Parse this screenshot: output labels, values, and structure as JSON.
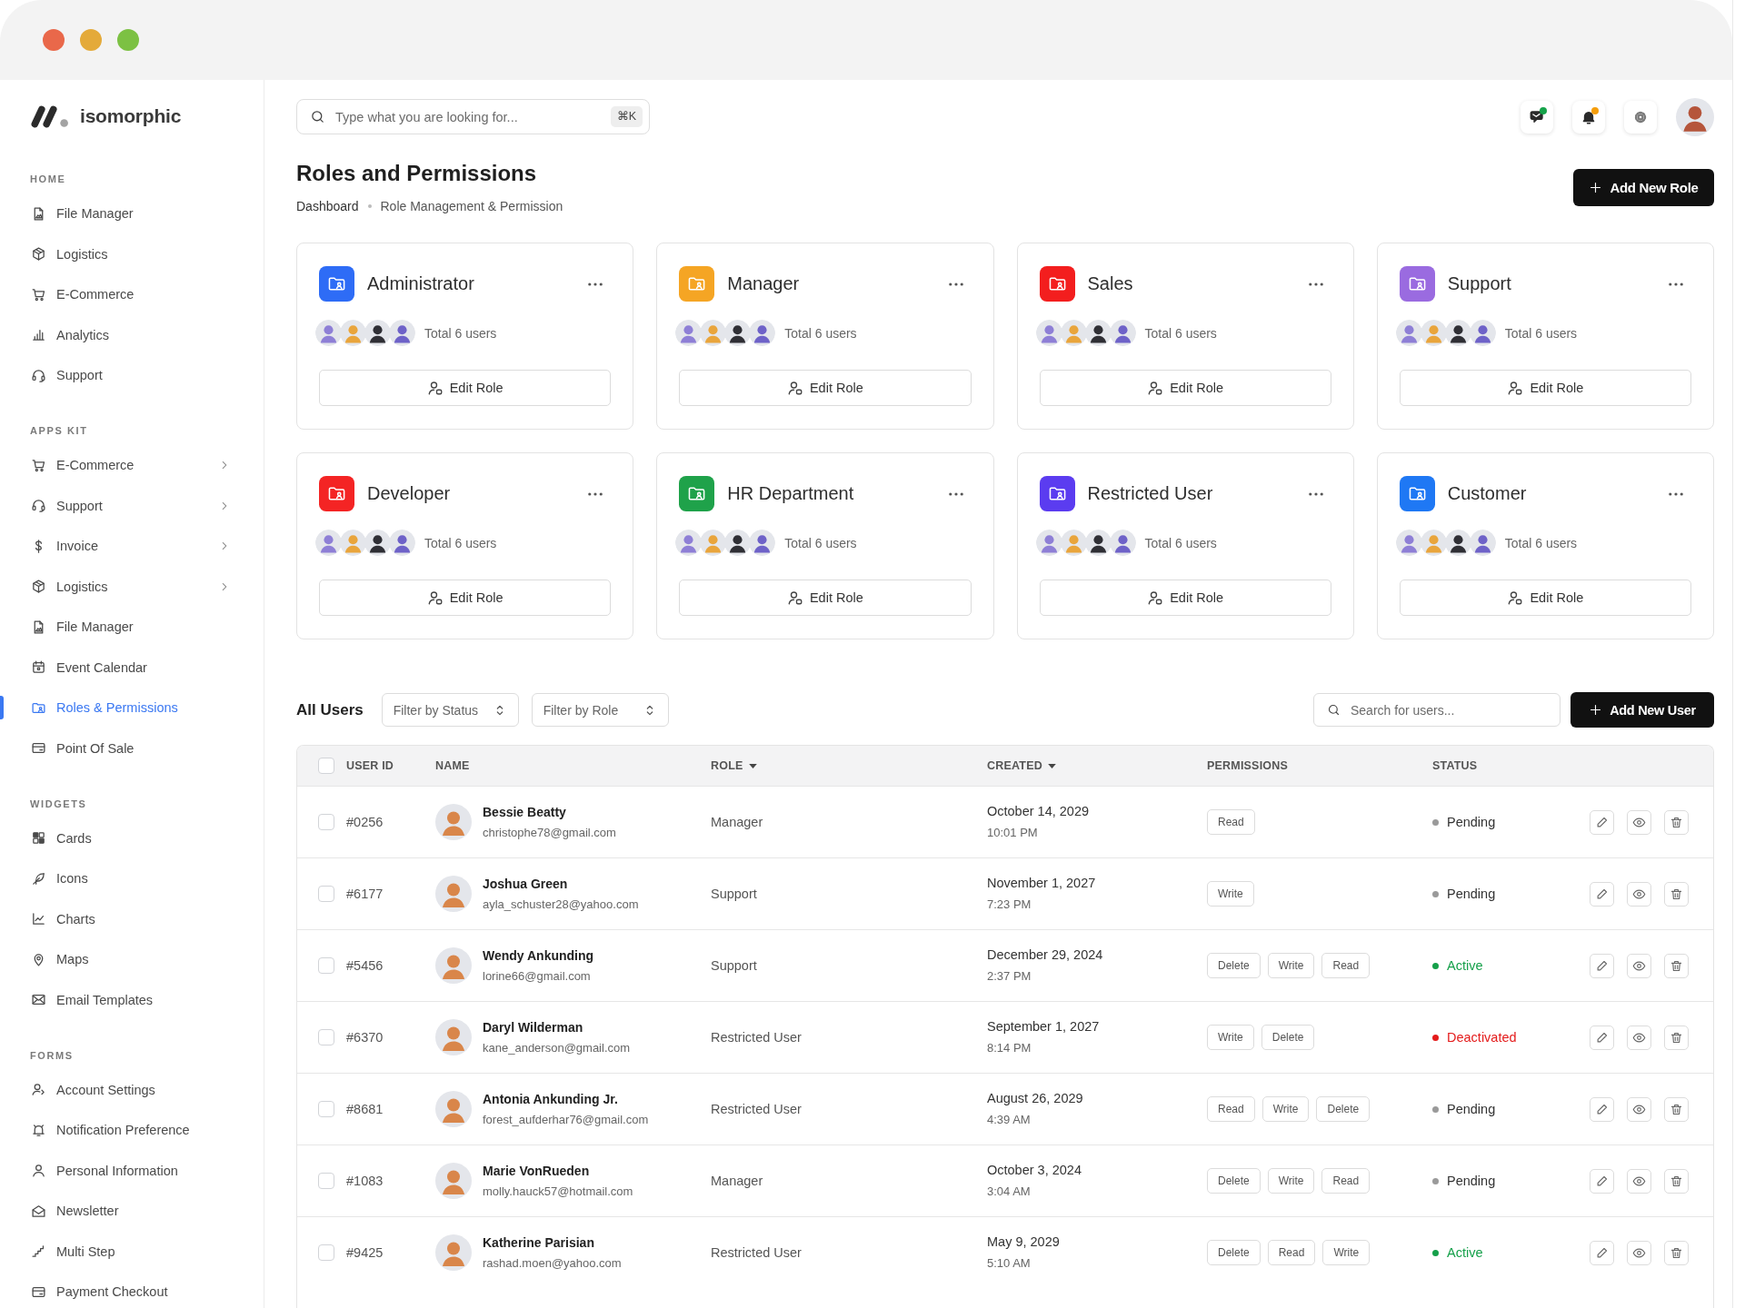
{
  "brand": {
    "name": "isomorphic"
  },
  "search": {
    "placeholder": "Type what you are looking for...",
    "shortcut": "⌘K"
  },
  "header": {
    "messages_unread": true,
    "notifications_unread": true
  },
  "sidebar": {
    "sections": [
      {
        "label": "HOME",
        "items": [
          {
            "label": "File Manager",
            "selected": false,
            "submenu": false
          },
          {
            "label": "Logistics",
            "selected": false,
            "submenu": false
          },
          {
            "label": "E-Commerce",
            "selected": false,
            "submenu": false
          },
          {
            "label": "Analytics",
            "selected": false,
            "submenu": false
          },
          {
            "label": "Support",
            "selected": false,
            "submenu": false
          }
        ]
      },
      {
        "label": "APPS KIT",
        "items": [
          {
            "label": "E-Commerce",
            "selected": false,
            "submenu": true
          },
          {
            "label": "Support",
            "selected": false,
            "submenu": true
          },
          {
            "label": "Invoice",
            "selected": false,
            "submenu": true
          },
          {
            "label": "Logistics",
            "selected": false,
            "submenu": true
          },
          {
            "label": "File Manager",
            "selected": false,
            "submenu": false
          },
          {
            "label": "Event Calendar",
            "selected": false,
            "submenu": false
          },
          {
            "label": "Roles & Permissions",
            "selected": true,
            "submenu": false
          },
          {
            "label": "Point Of Sale",
            "selected": false,
            "submenu": false
          }
        ]
      },
      {
        "label": "WIDGETS",
        "items": [
          {
            "label": "Cards",
            "selected": false,
            "submenu": false
          },
          {
            "label": "Icons",
            "selected": false,
            "submenu": false
          },
          {
            "label": "Charts",
            "selected": false,
            "submenu": false
          },
          {
            "label": "Maps",
            "selected": false,
            "submenu": false
          },
          {
            "label": "Email Templates",
            "selected": false,
            "submenu": false
          }
        ]
      },
      {
        "label": "FORMS",
        "items": [
          {
            "label": "Account Settings",
            "selected": false,
            "submenu": false
          },
          {
            "label": "Notification Preference",
            "selected": false,
            "submenu": false
          },
          {
            "label": "Personal Information",
            "selected": false,
            "submenu": false
          },
          {
            "label": "Newsletter",
            "selected": false,
            "submenu": false
          },
          {
            "label": "Multi Step",
            "selected": false,
            "submenu": false
          },
          {
            "label": "Payment Checkout",
            "selected": false,
            "submenu": false
          }
        ]
      }
    ]
  },
  "page": {
    "title": "Roles and Permissions",
    "breadcrumb": [
      "Dashboard",
      "Role Management & Permission"
    ],
    "primary_action": "Add New Role"
  },
  "roles": [
    {
      "name": "Administrator",
      "color": "#2e6cf6",
      "users": "Total 6 users",
      "action": "Edit Role"
    },
    {
      "name": "Manager",
      "color": "#f5a524",
      "users": "Total 6 users",
      "action": "Edit Role"
    },
    {
      "name": "Sales",
      "color": "#f31e1e",
      "users": "Total 6 users",
      "action": "Edit Role"
    },
    {
      "name": "Support",
      "color": "#9a6be0",
      "users": "Total 6 users",
      "action": "Edit Role"
    },
    {
      "name": "Developer",
      "color": "#f42424",
      "users": "Total 6 users",
      "action": "Edit Role"
    },
    {
      "name": "HR Department",
      "color": "#1fa24a",
      "users": "Total 6 users",
      "action": "Edit Role"
    },
    {
      "name": "Restricted User",
      "color": "#5b3cf0",
      "users": "Total 6 users",
      "action": "Edit Role"
    },
    {
      "name": "Customer",
      "color": "#1f78f4",
      "users": "Total 6 users",
      "action": "Edit Role"
    }
  ],
  "users_table": {
    "title": "All Users",
    "filters": [
      {
        "label": "Filter by Status"
      },
      {
        "label": "Filter by Role"
      }
    ],
    "search": {
      "placeholder": "Search for users..."
    },
    "primary_action": "Add New User",
    "select_all": {
      "checked": false
    },
    "columns": [
      {
        "label": "USER ID",
        "sortable": false
      },
      {
        "label": "NAME",
        "sortable": false
      },
      {
        "label": "ROLE",
        "sortable": true
      },
      {
        "label": "CREATED",
        "sortable": true
      },
      {
        "label": "PERMISSIONS",
        "sortable": false
      },
      {
        "label": "STATUS",
        "sortable": false
      }
    ],
    "rows": [
      {
        "checked": false,
        "id": "#0256",
        "name": "Bessie Beatty",
        "email": "christophe78@gmail.com",
        "role": "Manager",
        "date": "October 14, 2029",
        "time": "10:01 PM",
        "permissions": [
          "Read"
        ],
        "status": {
          "label": "Pending",
          "kind": "pending",
          "color": "#9a9a9a"
        }
      },
      {
        "checked": false,
        "id": "#6177",
        "name": "Joshua Green",
        "email": "ayla_schuster28@yahoo.com",
        "role": "Support",
        "date": "November 1, 2027",
        "time": "7:23 PM",
        "permissions": [
          "Write"
        ],
        "status": {
          "label": "Pending",
          "kind": "pending",
          "color": "#9a9a9a"
        }
      },
      {
        "checked": false,
        "id": "#5456",
        "name": "Wendy Ankunding",
        "email": "lorine66@gmail.com",
        "role": "Support",
        "date": "December 29, 2024",
        "time": "2:37 PM",
        "permissions": [
          "Delete",
          "Write",
          "Read"
        ],
        "status": {
          "label": "Active",
          "kind": "active",
          "color": "#15a04a"
        }
      },
      {
        "checked": false,
        "id": "#6370",
        "name": "Daryl Wilderman",
        "email": "kane_anderson@gmail.com",
        "role": "Restricted User",
        "date": "September 1, 2027",
        "time": "8:14 PM",
        "permissions": [
          "Write",
          "Delete"
        ],
        "status": {
          "label": "Deactivated",
          "kind": "deactivated",
          "color": "#e41b1b"
        }
      },
      {
        "checked": false,
        "id": "#8681",
        "name": "Antonia Ankunding Jr.",
        "email": "forest_aufderhar76@gmail.com",
        "role": "Restricted User",
        "date": "August 26, 2029",
        "time": "4:39 AM",
        "permissions": [
          "Read",
          "Write",
          "Delete"
        ],
        "status": {
          "label": "Pending",
          "kind": "pending",
          "color": "#9a9a9a"
        }
      },
      {
        "checked": false,
        "id": "#1083",
        "name": "Marie VonRueden",
        "email": "molly.hauck57@hotmail.com",
        "role": "Manager",
        "date": "October 3, 2024",
        "time": "3:04 AM",
        "permissions": [
          "Delete",
          "Write",
          "Read"
        ],
        "status": {
          "label": "Pending",
          "kind": "pending",
          "color": "#9a9a9a"
        }
      },
      {
        "checked": false,
        "id": "#9425",
        "name": "Katherine Parisian",
        "email": "rashad.moen@yahoo.com",
        "role": "Restricted User",
        "date": "May 9, 2029",
        "time": "5:10 AM",
        "permissions": [
          "Delete",
          "Read",
          "Write"
        ],
        "status": {
          "label": "Active",
          "kind": "active",
          "color": "#15a04a"
        }
      }
    ]
  }
}
